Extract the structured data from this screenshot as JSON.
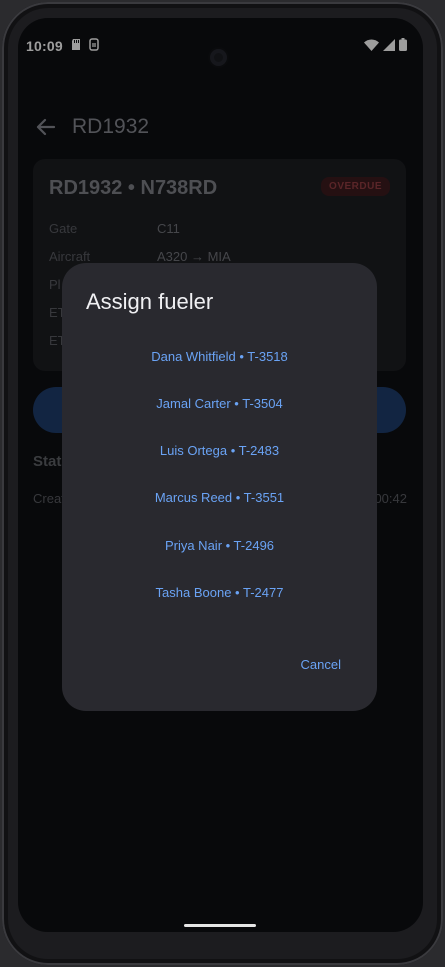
{
  "status_bar": {
    "time": "10:09"
  },
  "app_bar": {
    "title": "RD1932"
  },
  "card": {
    "title": "RD1932 • N738RD",
    "badge": "OVERDUE",
    "rows": [
      {
        "key": "Gate",
        "value": "C11"
      },
      {
        "key": "Aircraft",
        "value": "A320 → MIA"
      },
      {
        "key": "Pl",
        "value": ""
      },
      {
        "key": "ET",
        "value": ""
      },
      {
        "key": "ET",
        "value": ""
      }
    ]
  },
  "status_section": {
    "label": "Stat",
    "created_label": "Creat",
    "created_time": "00:42"
  },
  "dialog": {
    "title": "Assign fueler",
    "options": [
      "Dana Whitfield  •  T-3518",
      "Jamal Carter  •  T-3504",
      "Luis Ortega  •  T-2483",
      "Marcus Reed  •  T-3551",
      "Priya Nair  •  T-2496",
      "Tasha Boone  •  T-2477"
    ],
    "cancel": "Cancel"
  },
  "colors": {
    "accent": "#6aa3f5",
    "dialog_bg": "#29292f",
    "screen_bg": "#0d0e11"
  }
}
